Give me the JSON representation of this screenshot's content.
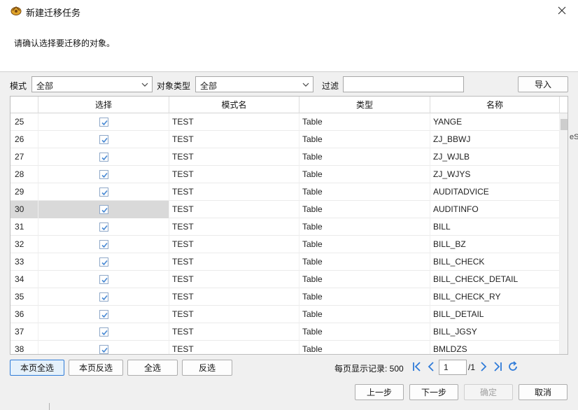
{
  "window": {
    "title": "新建迁移任务"
  },
  "header": {
    "instruction": "请确认选择要迁移的对象。"
  },
  "filters": {
    "schema_label": "模式",
    "schema_value": "全部",
    "type_label": "对象类型",
    "type_value": "全部",
    "filter_label": "过滤",
    "filter_value": "",
    "import_label": "导入"
  },
  "table": {
    "columns": [
      "",
      "选择",
      "模式名",
      "类型",
      "名称"
    ],
    "rows": [
      {
        "num": "25",
        "schema": "TEST",
        "type": "Table",
        "name": "YANGE",
        "checked": true
      },
      {
        "num": "26",
        "schema": "TEST",
        "type": "Table",
        "name": "ZJ_BBWJ",
        "checked": true
      },
      {
        "num": "27",
        "schema": "TEST",
        "type": "Table",
        "name": "ZJ_WJLB",
        "checked": true
      },
      {
        "num": "28",
        "schema": "TEST",
        "type": "Table",
        "name": "ZJ_WJYS",
        "checked": true
      },
      {
        "num": "29",
        "schema": "TEST",
        "type": "Table",
        "name": "AUDITADVICE",
        "checked": true
      },
      {
        "num": "30",
        "schema": "TEST",
        "type": "Table",
        "name": "AUDITINFO",
        "checked": true
      },
      {
        "num": "31",
        "schema": "TEST",
        "type": "Table",
        "name": "BILL",
        "checked": true
      },
      {
        "num": "32",
        "schema": "TEST",
        "type": "Table",
        "name": "BILL_BZ",
        "checked": true
      },
      {
        "num": "33",
        "schema": "TEST",
        "type": "Table",
        "name": "BILL_CHECK",
        "checked": true
      },
      {
        "num": "34",
        "schema": "TEST",
        "type": "Table",
        "name": "BILL_CHECK_DETAIL",
        "checked": true
      },
      {
        "num": "35",
        "schema": "TEST",
        "type": "Table",
        "name": "BILL_CHECK_RY",
        "checked": true
      },
      {
        "num": "36",
        "schema": "TEST",
        "type": "Table",
        "name": "BILL_DETAIL",
        "checked": true
      },
      {
        "num": "37",
        "schema": "TEST",
        "type": "Table",
        "name": "BILL_JGSY",
        "checked": true
      },
      {
        "num": "38",
        "schema": "TEST",
        "type": "Table",
        "name": "BMLDZS",
        "checked": true
      }
    ]
  },
  "actions": {
    "select_page": "本页全选",
    "invert_page": "本页反选",
    "select_all": "全选",
    "invert_all": "反选"
  },
  "pager": {
    "label": "每页显示记录: 500",
    "current_page": "1",
    "total": "/1"
  },
  "footer": {
    "prev": "上一步",
    "next": "下一步",
    "ok": "确定",
    "cancel": "取消"
  },
  "side_fragment": "eS",
  "colors": {
    "accent": "#2f7bd8",
    "check": "#4a8ad4",
    "selected_row": "#d9d9d9"
  }
}
